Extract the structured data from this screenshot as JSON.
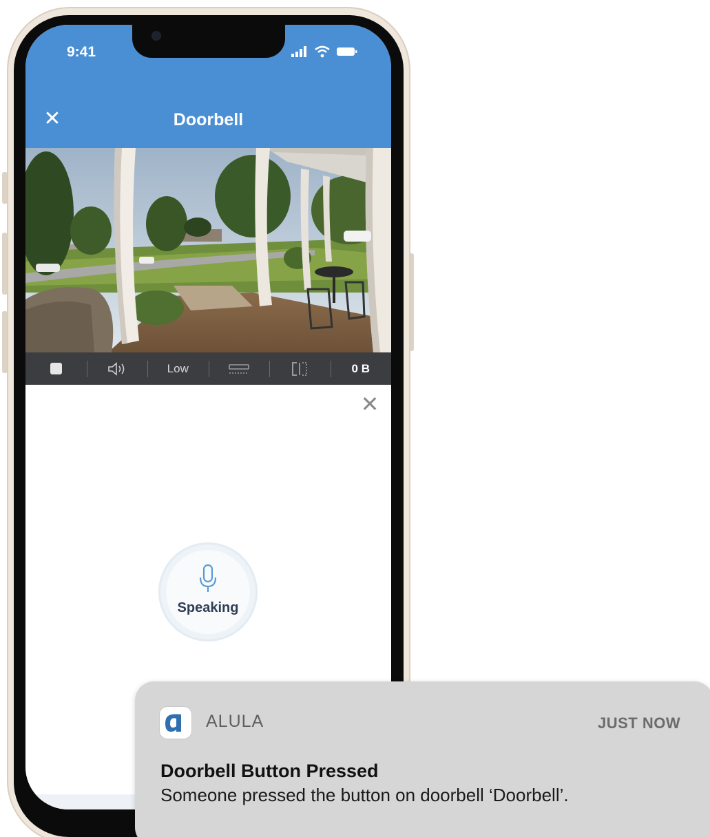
{
  "status_bar": {
    "time": "9:41"
  },
  "app": {
    "title": "Doorbell"
  },
  "toolbar": {
    "quality": "Low",
    "bytes": "0 B"
  },
  "talk": {
    "label": "Speaking"
  },
  "notification": {
    "app_name": "ALULA",
    "time": "JUST NOW",
    "title": "Doorbell Button Pressed",
    "body": "Someone pressed the button on doorbell ‘Doorbell’.",
    "icon_color": "#2f6fb0"
  },
  "colors": {
    "header_bg": "#4a8fd4",
    "toolbar_bg": "#3c3d40",
    "notification_bg": "#d6d6d6"
  }
}
